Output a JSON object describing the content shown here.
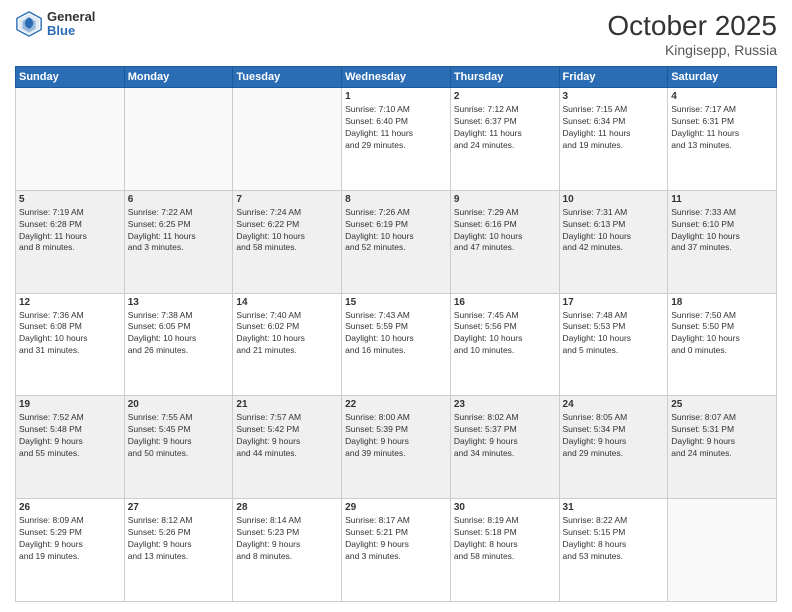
{
  "header": {
    "logo_general": "General",
    "logo_blue": "Blue",
    "title": "October 2025",
    "subtitle": "Kingisepp, Russia"
  },
  "days_of_week": [
    "Sunday",
    "Monday",
    "Tuesday",
    "Wednesday",
    "Thursday",
    "Friday",
    "Saturday"
  ],
  "weeks": [
    [
      {
        "day": "",
        "info": "",
        "empty": true
      },
      {
        "day": "",
        "info": "",
        "empty": true
      },
      {
        "day": "",
        "info": "",
        "empty": true
      },
      {
        "day": "1",
        "info": "Sunrise: 7:10 AM\nSunset: 6:40 PM\nDaylight: 11 hours\nand 29 minutes."
      },
      {
        "day": "2",
        "info": "Sunrise: 7:12 AM\nSunset: 6:37 PM\nDaylight: 11 hours\nand 24 minutes."
      },
      {
        "day": "3",
        "info": "Sunrise: 7:15 AM\nSunset: 6:34 PM\nDaylight: 11 hours\nand 19 minutes."
      },
      {
        "day": "4",
        "info": "Sunrise: 7:17 AM\nSunset: 6:31 PM\nDaylight: 11 hours\nand 13 minutes."
      }
    ],
    [
      {
        "day": "5",
        "info": "Sunrise: 7:19 AM\nSunset: 6:28 PM\nDaylight: 11 hours\nand 8 minutes.",
        "shaded": true
      },
      {
        "day": "6",
        "info": "Sunrise: 7:22 AM\nSunset: 6:25 PM\nDaylight: 11 hours\nand 3 minutes.",
        "shaded": true
      },
      {
        "day": "7",
        "info": "Sunrise: 7:24 AM\nSunset: 6:22 PM\nDaylight: 10 hours\nand 58 minutes.",
        "shaded": true
      },
      {
        "day": "8",
        "info": "Sunrise: 7:26 AM\nSunset: 6:19 PM\nDaylight: 10 hours\nand 52 minutes.",
        "shaded": true
      },
      {
        "day": "9",
        "info": "Sunrise: 7:29 AM\nSunset: 6:16 PM\nDaylight: 10 hours\nand 47 minutes.",
        "shaded": true
      },
      {
        "day": "10",
        "info": "Sunrise: 7:31 AM\nSunset: 6:13 PM\nDaylight: 10 hours\nand 42 minutes.",
        "shaded": true
      },
      {
        "day": "11",
        "info": "Sunrise: 7:33 AM\nSunset: 6:10 PM\nDaylight: 10 hours\nand 37 minutes.",
        "shaded": true
      }
    ],
    [
      {
        "day": "12",
        "info": "Sunrise: 7:36 AM\nSunset: 6:08 PM\nDaylight: 10 hours\nand 31 minutes."
      },
      {
        "day": "13",
        "info": "Sunrise: 7:38 AM\nSunset: 6:05 PM\nDaylight: 10 hours\nand 26 minutes."
      },
      {
        "day": "14",
        "info": "Sunrise: 7:40 AM\nSunset: 6:02 PM\nDaylight: 10 hours\nand 21 minutes."
      },
      {
        "day": "15",
        "info": "Sunrise: 7:43 AM\nSunset: 5:59 PM\nDaylight: 10 hours\nand 16 minutes."
      },
      {
        "day": "16",
        "info": "Sunrise: 7:45 AM\nSunset: 5:56 PM\nDaylight: 10 hours\nand 10 minutes."
      },
      {
        "day": "17",
        "info": "Sunrise: 7:48 AM\nSunset: 5:53 PM\nDaylight: 10 hours\nand 5 minutes."
      },
      {
        "day": "18",
        "info": "Sunrise: 7:50 AM\nSunset: 5:50 PM\nDaylight: 10 hours\nand 0 minutes."
      }
    ],
    [
      {
        "day": "19",
        "info": "Sunrise: 7:52 AM\nSunset: 5:48 PM\nDaylight: 9 hours\nand 55 minutes.",
        "shaded": true
      },
      {
        "day": "20",
        "info": "Sunrise: 7:55 AM\nSunset: 5:45 PM\nDaylight: 9 hours\nand 50 minutes.",
        "shaded": true
      },
      {
        "day": "21",
        "info": "Sunrise: 7:57 AM\nSunset: 5:42 PM\nDaylight: 9 hours\nand 44 minutes.",
        "shaded": true
      },
      {
        "day": "22",
        "info": "Sunrise: 8:00 AM\nSunset: 5:39 PM\nDaylight: 9 hours\nand 39 minutes.",
        "shaded": true
      },
      {
        "day": "23",
        "info": "Sunrise: 8:02 AM\nSunset: 5:37 PM\nDaylight: 9 hours\nand 34 minutes.",
        "shaded": true
      },
      {
        "day": "24",
        "info": "Sunrise: 8:05 AM\nSunset: 5:34 PM\nDaylight: 9 hours\nand 29 minutes.",
        "shaded": true
      },
      {
        "day": "25",
        "info": "Sunrise: 8:07 AM\nSunset: 5:31 PM\nDaylight: 9 hours\nand 24 minutes.",
        "shaded": true
      }
    ],
    [
      {
        "day": "26",
        "info": "Sunrise: 8:09 AM\nSunset: 5:29 PM\nDaylight: 9 hours\nand 19 minutes."
      },
      {
        "day": "27",
        "info": "Sunrise: 8:12 AM\nSunset: 5:26 PM\nDaylight: 9 hours\nand 13 minutes."
      },
      {
        "day": "28",
        "info": "Sunrise: 8:14 AM\nSunset: 5:23 PM\nDaylight: 9 hours\nand 8 minutes."
      },
      {
        "day": "29",
        "info": "Sunrise: 8:17 AM\nSunset: 5:21 PM\nDaylight: 9 hours\nand 3 minutes."
      },
      {
        "day": "30",
        "info": "Sunrise: 8:19 AM\nSunset: 5:18 PM\nDaylight: 8 hours\nand 58 minutes."
      },
      {
        "day": "31",
        "info": "Sunrise: 8:22 AM\nSunset: 5:15 PM\nDaylight: 8 hours\nand 53 minutes."
      },
      {
        "day": "",
        "info": "",
        "empty": true
      }
    ]
  ]
}
